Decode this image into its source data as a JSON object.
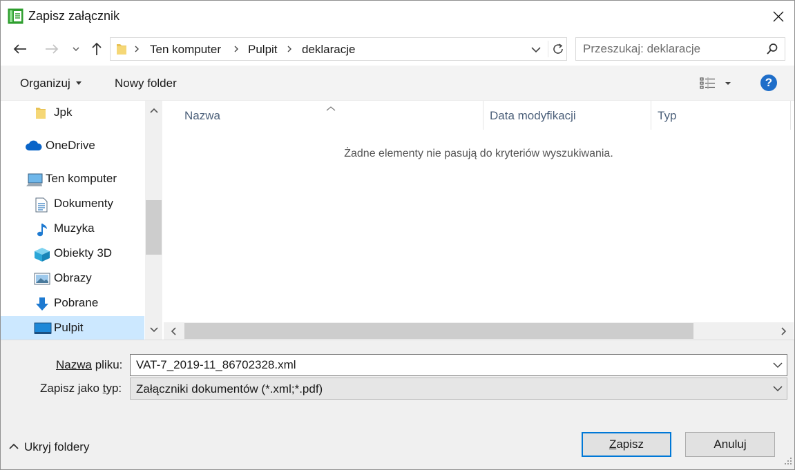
{
  "window": {
    "title": "Zapisz załącznik"
  },
  "navigation": {
    "breadcrumbs": [
      "Ten komputer",
      "Pulpit",
      "deklaracje"
    ]
  },
  "search": {
    "placeholder": "Przeszukaj: deklaracje"
  },
  "toolbar": {
    "organize_label": "Organizuj",
    "new_folder_label": "Nowy folder",
    "help_label": "?"
  },
  "sidebar": {
    "items": [
      {
        "label": "Jpk",
        "icon": "folder-icon"
      },
      {
        "label": "OneDrive",
        "icon": "cloud-icon"
      },
      {
        "label": "Ten komputer",
        "icon": "computer-icon"
      },
      {
        "label": "Dokumenty",
        "icon": "document-icon"
      },
      {
        "label": "Muzyka",
        "icon": "music-icon"
      },
      {
        "label": "Obiekty 3D",
        "icon": "cube-icon"
      },
      {
        "label": "Obrazy",
        "icon": "image-icon"
      },
      {
        "label": "Pobrane",
        "icon": "download-icon"
      },
      {
        "label": "Pulpit",
        "icon": "desktop-icon"
      }
    ],
    "selected": "Pulpit"
  },
  "filelist": {
    "columns": [
      "Nazwa",
      "Data modyfikacji",
      "Typ"
    ],
    "empty_message": "Żadne elementy nie pasują do kryteriów wyszukiwania."
  },
  "form": {
    "filename_label_prefix": "Nazwa",
    "filename_label_suffix": " pliku:",
    "filename_value": "VAT-7_2019-11_86702328.xml",
    "filetype_label_prefix": "Zapisz jako ",
    "filetype_label_underlined": "t",
    "filetype_label_suffix": "yp:",
    "filetype_value": "Załączniki dokumentów (*.xml;*.pdf)"
  },
  "footer": {
    "hide_folders_label": "Ukryj foldery",
    "save_label_underlined": "Z",
    "save_label_rest": "apisz",
    "cancel_label": "Anuluj"
  },
  "colors": {
    "accent": "#0078d7",
    "selected_bg": "#cce8ff",
    "help_icon": "#1f6ec9"
  }
}
